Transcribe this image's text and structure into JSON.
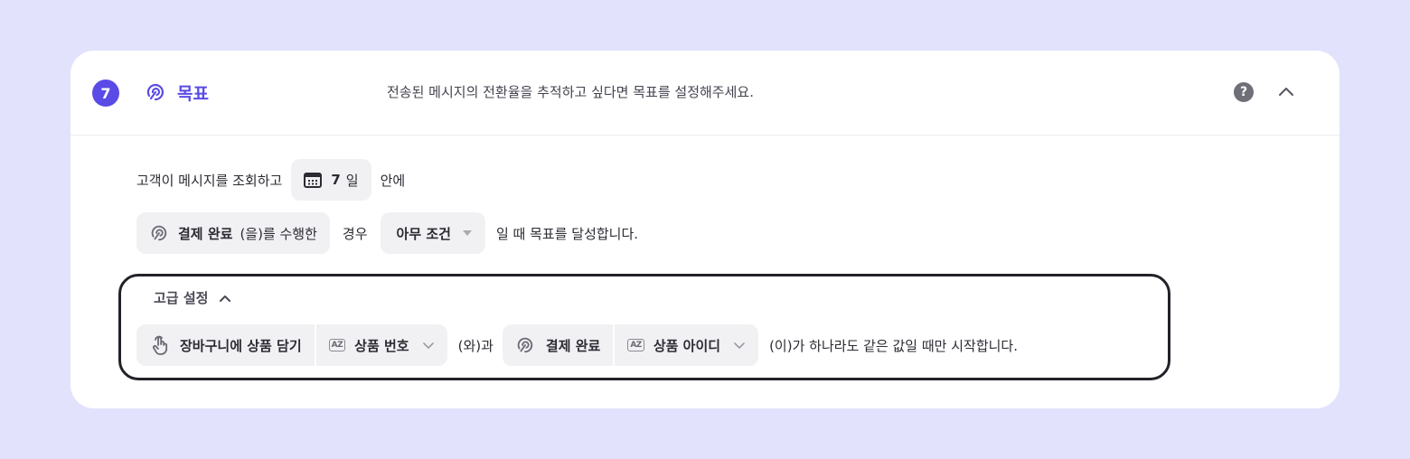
{
  "step": {
    "number": "7",
    "title": "목표",
    "description": "전송된 메시지의 전환율을 추적하고 싶다면 목표를 설정해주세요."
  },
  "header": {
    "help_icon": "question-circle-icon",
    "collapse_icon": "chevron-up-icon",
    "help_glyph": "?"
  },
  "line1": {
    "prefix": "고객이 메시지를 조회하고",
    "days_value": "7",
    "days_unit": "일",
    "suffix": "안에"
  },
  "line2": {
    "event_name": "결제 완료",
    "event_suffix": "(을)를 수행한",
    "case_label": "경우",
    "condition_value": "아무 조건",
    "suffix": "일 때 목표를 달성합니다."
  },
  "advanced": {
    "title": "고급 설정",
    "left_event": "장바구니에 상품 담기",
    "left_property": "상품 번호",
    "connector": "(와)과",
    "right_event": "결제 완료",
    "right_property": "상품 아이디",
    "suffix": "(이)가 하나라도 같은 값일 때만 시작합니다.",
    "az_label": "AZ"
  },
  "colors": {
    "accent": "#5b4be6",
    "background": "#e3e2fd",
    "chip": "#f1f1f4",
    "outline": "#222228"
  }
}
